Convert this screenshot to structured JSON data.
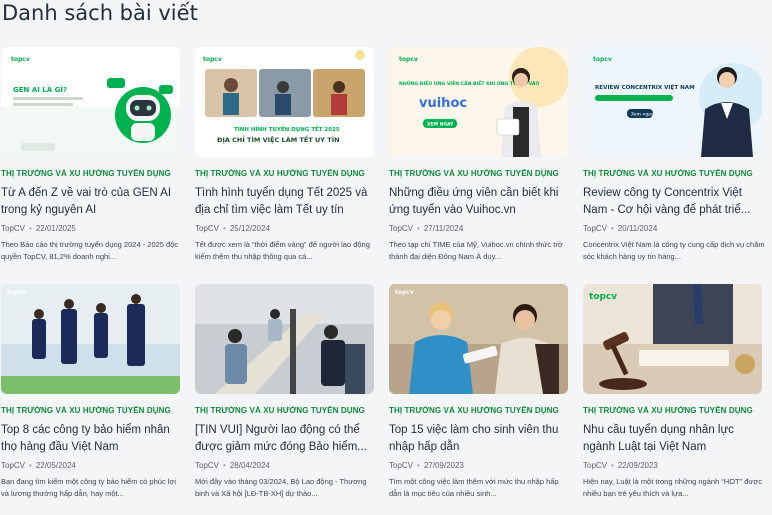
{
  "page_title": "Danh sách bài viết",
  "brand_color": "#00b14f",
  "posts": [
    {
      "thumb_logo": "topcv",
      "thumb_text": "GEN AI LÀ GÌ?",
      "category": "THỊ TRƯỜNG VÀ XU HƯỚNG TUYỂN DỤNG",
      "title": "Từ A đến Z về vai trò của GEN AI trong kỷ nguyên AI",
      "author": "TopCV",
      "date": "22/01/2025",
      "excerpt": "Theo Báo cáo thị trường tuyển dụng 2024 - 2025 độc quyền TopCV, 81,2% doanh nghi..."
    },
    {
      "thumb_logo": "topcv",
      "thumb_text": "TÌNH HÌNH TUYỂN DỤNG TẾT 2025",
      "thumb_subtext": "ĐỊA CHỈ TÌM VIỆC LÀM TẾT UY TÍN",
      "category": "THỊ TRƯỜNG VÀ XU HƯỚNG TUYỂN DỤNG",
      "title": "Tình hình tuyển dụng Tết 2025 và địa chỉ tìm việc làm Tết uy tín",
      "author": "TopCV",
      "date": "25/12/2024",
      "excerpt": "Tết được xem là “thời điểm vàng” để người lao động kiếm thêm thu nhập thông qua cá..."
    },
    {
      "thumb_logo": "topcv",
      "thumb_text": "NHỮNG ĐIỀU ỨNG VIÊN CẦN BIẾT KHI ỨNG TUYỂN VÀO",
      "thumb_brand": "vuihoc",
      "thumb_button": "XEM NGAY",
      "category": "THỊ TRƯỜNG VÀ XU HƯỚNG TUYỂN DỤNG",
      "title": "Những điều ứng viên cần biết khi ứng tuyển vào Vuihoc.vn",
      "author": "TopCV",
      "date": "27/11/2024",
      "excerpt": "Theo tạp chí TIME của Mỹ, Vuihoc.vn chính thức trở thành đại diện Đông Nam Á duy..."
    },
    {
      "thumb_logo": "topcv",
      "thumb_text": "REVIEW CONCENTRIX VIỆT NAM",
      "thumb_button": "Xem ngay",
      "category": "THỊ TRƯỜNG VÀ XU HƯỚNG TUYỂN DỤNG",
      "title": "Review công ty Concentrix Việt Nam - Cơ hội vàng để phát triể...",
      "author": "TopCV",
      "date": "20/11/2024",
      "excerpt": "Concentrix Việt Nam là công ty cung cấp dịch vụ chăm sóc khách hàng uy tín hàng..."
    },
    {
      "thumb_logo": "topcv",
      "category": "THỊ TRƯỜNG VÀ XU HƯỚNG TUYỂN DỤNG",
      "title": "Top 8 các công ty bảo hiểm nhân thọ hàng đầu Việt Nam",
      "author": "TopCV",
      "date": "22/05/2024",
      "excerpt": "Bạn đang tìm kiếm một công ty bảo hiểm có phúc lợi và lương thưởng hấp dẫn, hay một..."
    },
    {
      "category": "THỊ TRƯỜNG VÀ XU HƯỚNG TUYỂN DỤNG",
      "title": "[TIN VUI] Người lao động có thể được giảm mức đóng Bảo hiểm...",
      "author": "TopCV",
      "date": "28/04/2024",
      "excerpt": "Mới đây vào tháng 03/2024, Bộ Lao động - Thương binh và Xã hội [LĐ-TB-XH] dự thảo..."
    },
    {
      "thumb_logo": "topcv",
      "category": "THỊ TRƯỜNG VÀ XU HƯỚNG TUYỂN DỤNG",
      "title": "Top 15 việc làm cho sinh viên thu nhập hấp dẫn",
      "author": "TopCV",
      "date": "27/09/2023",
      "excerpt": "Tìm một công việc làm thêm với mức thu nhập hấp dẫn là mục tiêu của nhiều sinh..."
    },
    {
      "thumb_logo": "topcv",
      "category": "THỊ TRƯỜNG VÀ XU HƯỚNG TUYỂN DỤNG",
      "title": "Nhu cầu tuyển dụng nhân lực ngành Luật tại Việt Nam",
      "author": "TopCV",
      "date": "22/09/2023",
      "excerpt": "Hiện nay, Luật là một trong những ngành “HOT” được nhiều bạn trẻ yêu thích và lựa..."
    }
  ]
}
